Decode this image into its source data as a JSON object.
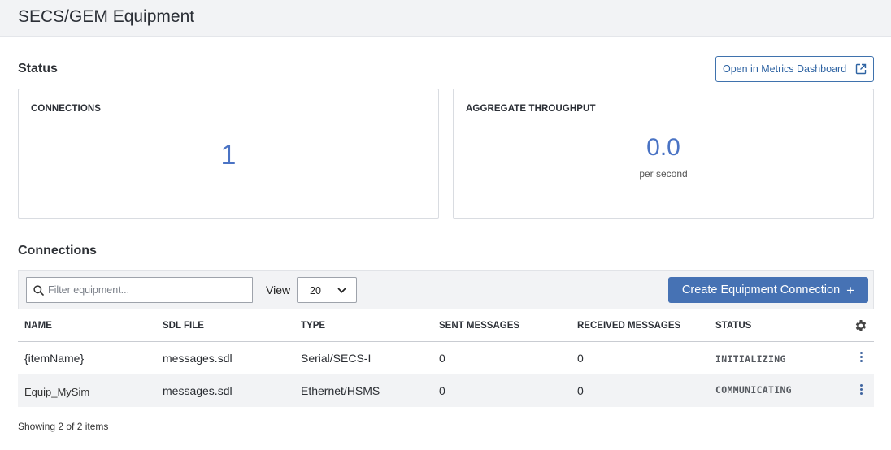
{
  "header": {
    "title": "SECS/GEM Equipment"
  },
  "status": {
    "title": "Status",
    "metrics_button": {
      "label": "Open in Metrics Dashboard",
      "icon": "external-link-icon"
    },
    "cards": {
      "connections": {
        "label": "CONNECTIONS",
        "value": "1"
      },
      "throughput": {
        "label": "AGGREGATE THROUGHPUT",
        "value": "0.0",
        "unit": "per second"
      }
    }
  },
  "connections": {
    "title": "Connections",
    "filter": {
      "placeholder": "Filter equipment...",
      "value": "",
      "icon": "search-icon"
    },
    "view": {
      "label": "View",
      "selected": "20"
    },
    "create_button": {
      "label": "Create Equipment Connection",
      "icon": "plus"
    },
    "columns": [
      "NAME",
      "SDL FILE",
      "TYPE",
      "SENT MESSAGES",
      "RECEIVED MESSAGES",
      "STATUS"
    ],
    "rows": [
      {
        "name": "{itemName}",
        "sdl_file": "messages.sdl",
        "type": "Serial/SECS-I",
        "sent": "0",
        "received": "0",
        "status": "INITIALIZING"
      },
      {
        "name": "Equip_MySim",
        "sdl_file": "messages.sdl",
        "type": "Ethernet/HSMS",
        "sent": "0",
        "received": "0",
        "status": "COMMUNICATING"
      }
    ],
    "footer": "Showing 2 of 2 items"
  },
  "colors": {
    "accent": "#4672b4",
    "value_blue": "#4a73c4",
    "header_bg": "#f2f3f5"
  }
}
